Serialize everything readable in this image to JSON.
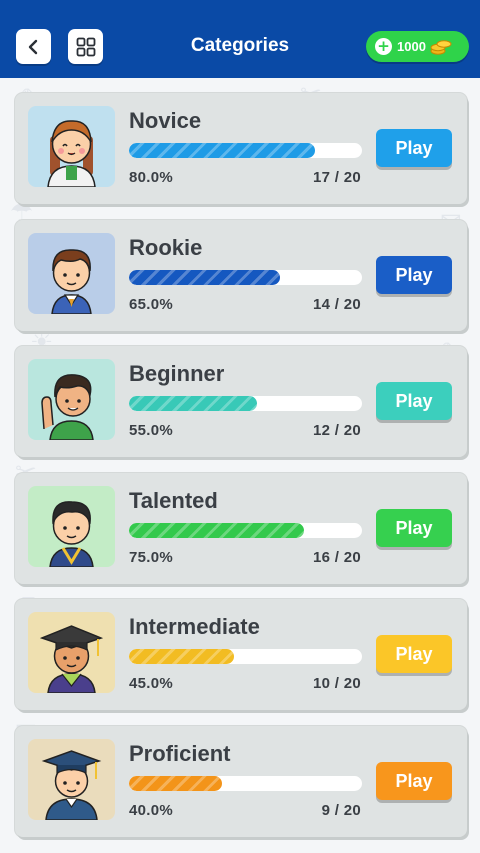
{
  "header": {
    "title": "Categories",
    "back_icon": "chevron-left-icon",
    "grid_icon": "grid-icon",
    "coins": {
      "amount": "1000",
      "add_icon": "plus-icon",
      "coin_icon": "coin-stack-icon"
    },
    "background_color": "#0a4aa6"
  },
  "levels": [
    {
      "name": "Novice",
      "percent_label": "80.0%",
      "progress": 0.8,
      "count_label": "17 / 20",
      "play_label": "Play",
      "color": "#1e9be6",
      "button_color": "#1fa0ea",
      "avatar_bg": "#bfe0ef",
      "avatar": "girl-avatar"
    },
    {
      "name": "Rookie",
      "percent_label": "65.0%",
      "progress": 0.65,
      "count_label": "14 / 20",
      "play_label": "Play",
      "color": "#1558c0",
      "button_color": "#1a5ec7",
      "avatar_bg": "#b9cde8",
      "avatar": "boy-avatar"
    },
    {
      "name": "Beginner",
      "percent_label": "55.0%",
      "progress": 0.55,
      "count_label": "12 / 20",
      "play_label": "Play",
      "color": "#38c9b7",
      "button_color": "#3ccfbd",
      "avatar_bg": "#b9e6de",
      "avatar": "waving-boy-avatar"
    },
    {
      "name": "Talented",
      "percent_label": "75.0%",
      "progress": 0.75,
      "count_label": "16 / 20",
      "play_label": "Play",
      "color": "#33c94c",
      "button_color": "#36d04f",
      "avatar_bg": "#c3ecc6",
      "avatar": "graduate-boy-avatar"
    },
    {
      "name": "Intermediate",
      "percent_label": "45.0%",
      "progress": 0.45,
      "count_label": "10 / 20",
      "play_label": "Play",
      "color": "#f2bc22",
      "button_color": "#fbc628",
      "avatar_bg": "#efe0b0",
      "avatar": "mortarboard-avatar"
    },
    {
      "name": "Proficient",
      "percent_label": "40.0%",
      "progress": 0.4,
      "count_label": "9 / 20",
      "play_label": "Play",
      "color": "#f39419",
      "button_color": "#f8961c",
      "avatar_bg": "#eadcbc",
      "avatar": "professor-avatar"
    }
  ]
}
